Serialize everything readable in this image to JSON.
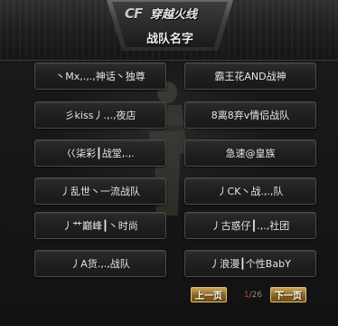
{
  "header": {
    "logo_cf": "CF",
    "logo_text": "穿越火线",
    "title": "战队名字"
  },
  "teams": [
    "丶Mx,.,.,神话丶独尊",
    "霸王花AND战神",
    "彡kiss丿.,.,夜店",
    "8离8弃v情侣战队",
    "巜柒彩┃战堂,.,.",
    "急速@皇族",
    "丿乱世丶一流战队",
    "丿CK丶战.,.,队",
    "丿艹巅峰┃丶时尚",
    "丿古惑仔┃.,.,社团",
    "丿A货.,.,战队",
    "丿浪漫┃个性BabY"
  ],
  "pagination": {
    "prev_label": "上一页",
    "next_label": "下一页",
    "current": "1",
    "separator": "/",
    "total": "26"
  },
  "colors": {
    "accent_gold": "#8a6420",
    "page_current": "#d23a1f"
  }
}
